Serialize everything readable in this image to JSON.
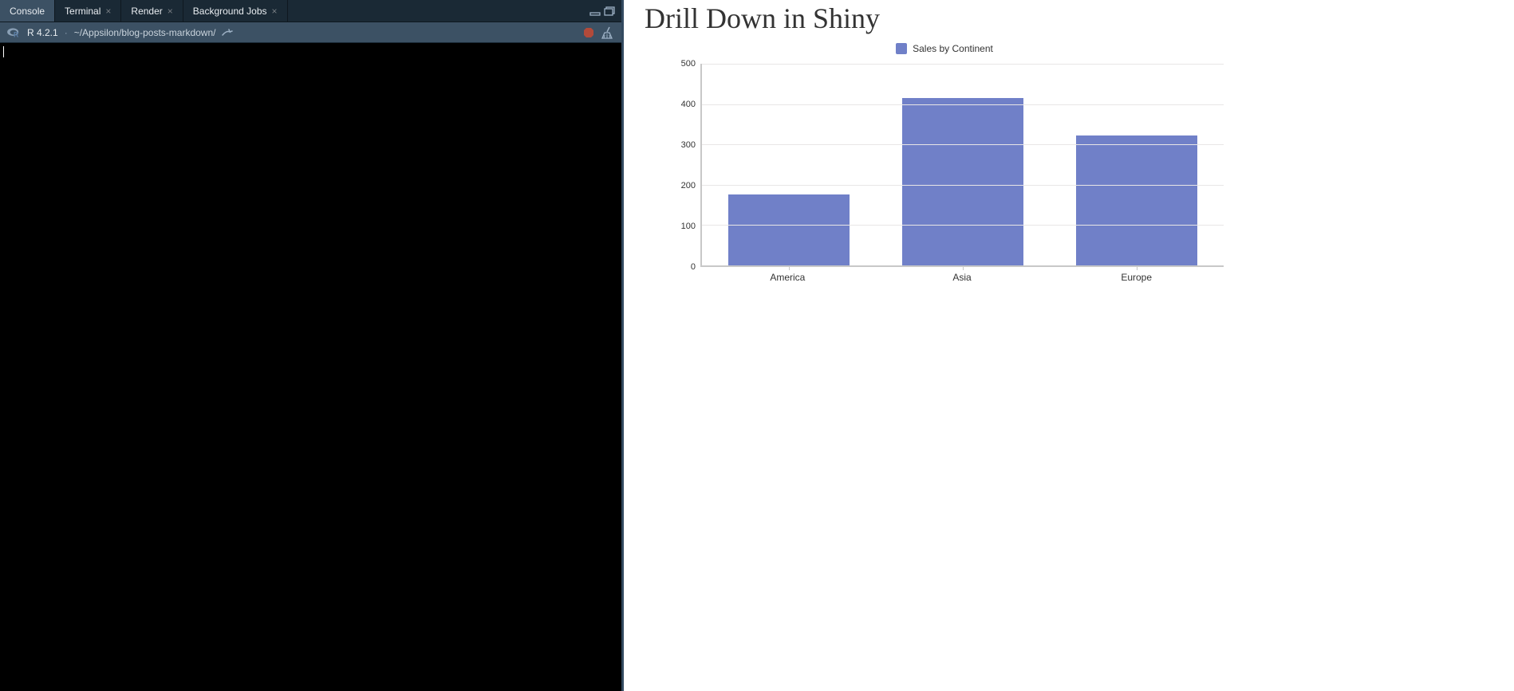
{
  "tabs": {
    "items": [
      {
        "label": "Console",
        "closable": false,
        "active": true
      },
      {
        "label": "Terminal",
        "closable": true,
        "active": false
      },
      {
        "label": "Render",
        "closable": true,
        "active": false
      },
      {
        "label": "Background Jobs",
        "closable": true,
        "active": false
      }
    ]
  },
  "toolbar": {
    "r_version": "R 4.2.1",
    "separator": "·",
    "path": "~/Appsilon/blog-posts-markdown/"
  },
  "page": {
    "title": "Drill Down in Shiny"
  },
  "chart_data": {
    "type": "bar",
    "legend": "Sales by Continent",
    "categories": [
      "America",
      "Asia",
      "Europe"
    ],
    "values": [
      175,
      415,
      322
    ],
    "ylim": [
      0,
      500
    ],
    "yticks": [
      0,
      100,
      200,
      300,
      400,
      500
    ],
    "bar_color": "#7080c8"
  }
}
